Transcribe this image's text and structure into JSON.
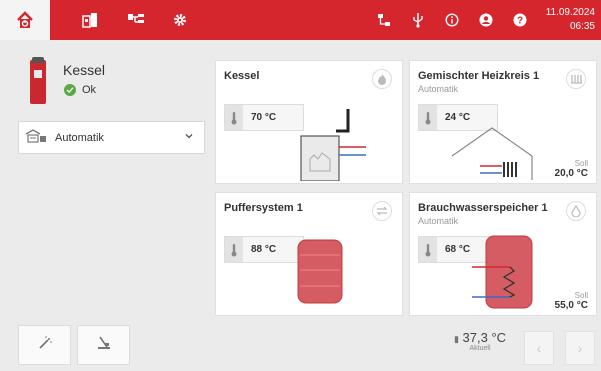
{
  "header": {
    "date": "11.09.2024",
    "time": "06:35",
    "accent_color": "#d5262e",
    "nav_icons": [
      "home-icon",
      "boiler-menu-icon",
      "system-menu-icon",
      "settings-icon"
    ],
    "action_icons": [
      "network-icon",
      "usb-icon",
      "info-icon",
      "user-icon",
      "help-icon"
    ]
  },
  "sidebar": {
    "title": "Kessel",
    "status": "Ok",
    "mode": "Automatik",
    "mode_icon": "automatic-mode-icon",
    "bottom_buttons": [
      "wand-icon",
      "chimney-sweep-icon"
    ]
  },
  "cards": {
    "kessel": {
      "title": "Kessel",
      "temp": "70 °C",
      "icon": "flame-icon"
    },
    "heizkreis": {
      "title": "Gemischter Heizkreis 1",
      "subtitle": "Automatik",
      "temp": "24 °C",
      "soll_label": "Soll",
      "soll_value": "20,0 °C",
      "icon": "heating-icon"
    },
    "puffer": {
      "title": "Puffersystem 1",
      "temp": "88 °C",
      "icon": "swap-icon"
    },
    "brauchwasser": {
      "title": "Brauchwasserspeicher 1",
      "subtitle": "Automatik",
      "temp": "68 °C",
      "soll_label": "Soll",
      "soll_value": "55,0 °C",
      "icon": "water-drop-icon"
    }
  },
  "footer": {
    "outdoor_temp": "37,3 °C",
    "outdoor_label": "Aktuell",
    "prev_label": "‹",
    "next_label": "›"
  }
}
